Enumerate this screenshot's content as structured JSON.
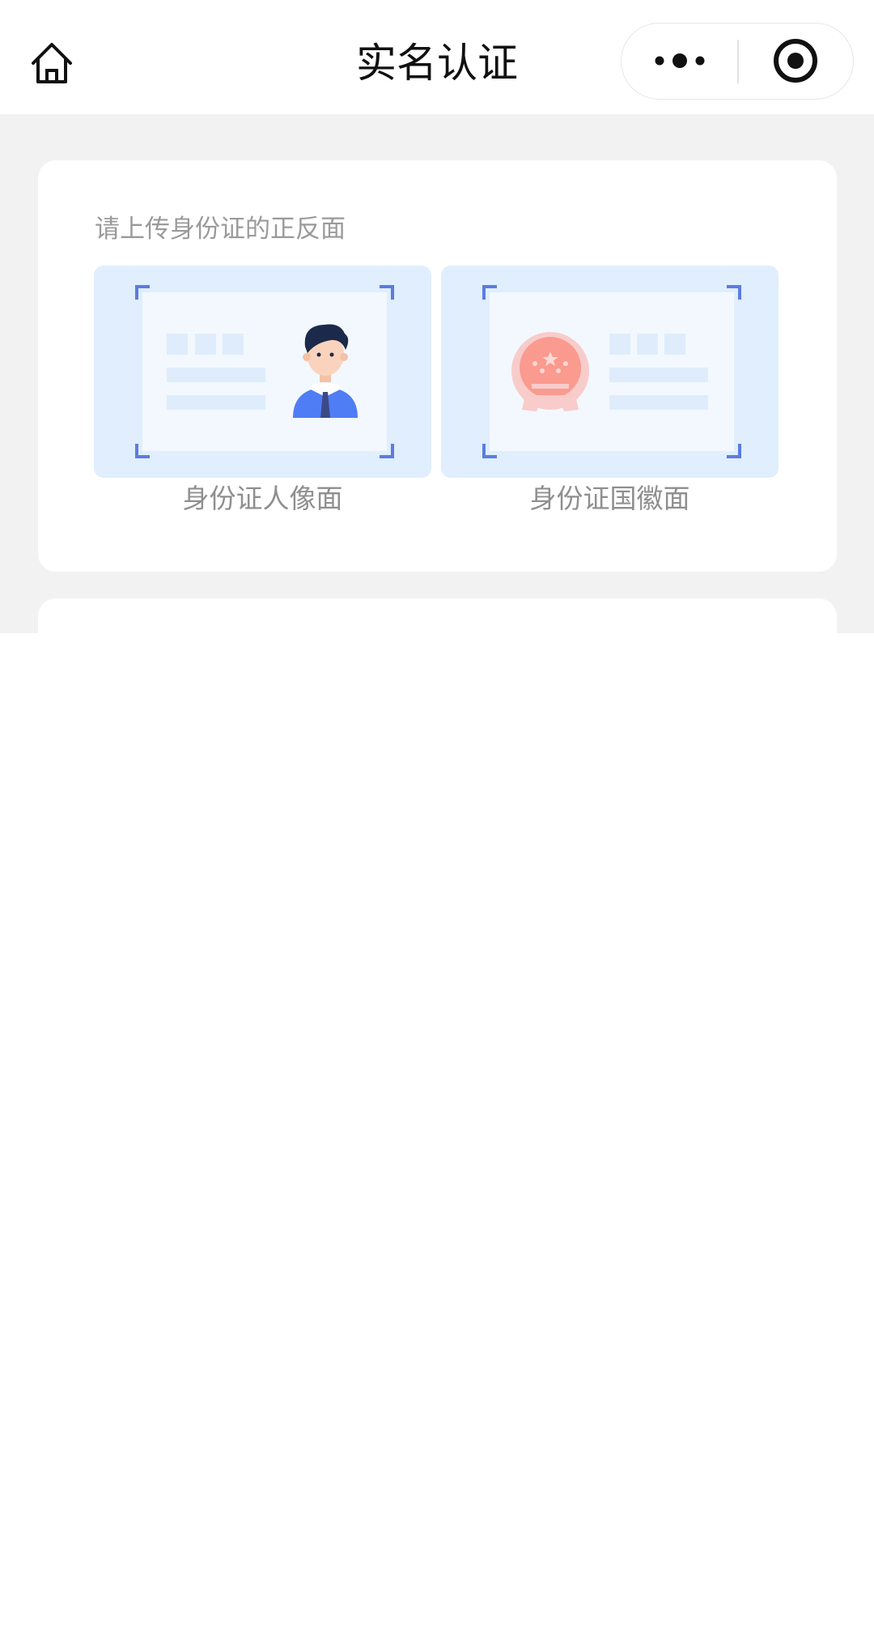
{
  "nav": {
    "title": "实名认证",
    "home_icon": "home-icon",
    "more_icon": "more-dots-icon",
    "close_icon": "record-target-icon"
  },
  "upload_card": {
    "hint": "请上传身份证的正反面",
    "front_label": "身份证人像面",
    "back_label": "身份证国徽面"
  },
  "colors": {
    "page_bg": "#f2f2f2",
    "slot_bg": "#e0eefe",
    "corner": "#5b7de0",
    "text_muted": "#9a9a9a"
  }
}
